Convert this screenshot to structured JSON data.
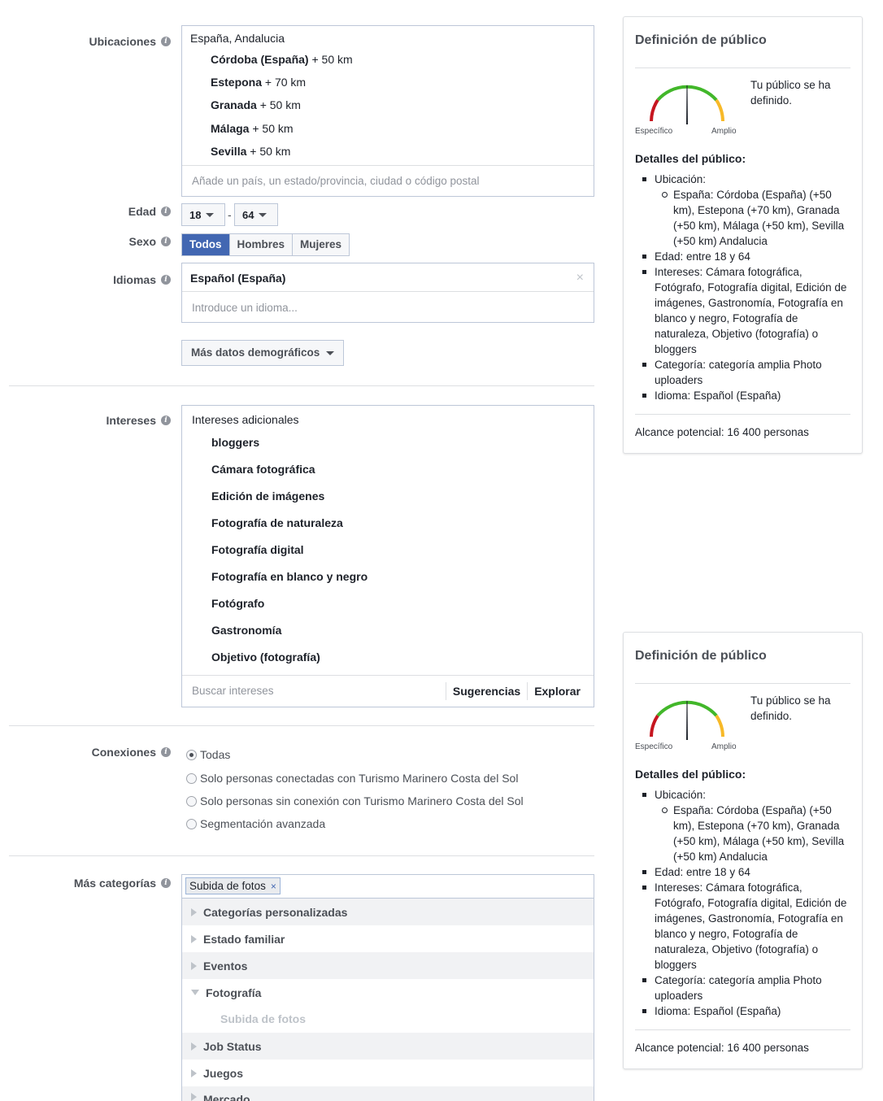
{
  "locations": {
    "label": "Ubicaciones",
    "region": "España, Andalucia",
    "items": [
      {
        "name": "Córdoba (España)",
        "radius": "+ 50 km"
      },
      {
        "name": "Estepona",
        "radius": "+ 70 km"
      },
      {
        "name": "Granada",
        "radius": "+ 50 km"
      },
      {
        "name": "Málaga",
        "radius": "+ 50 km"
      },
      {
        "name": "Sevilla",
        "radius": "+ 50 km"
      }
    ],
    "placeholder": "Añade un país, un estado/provincia, ciudad o código postal"
  },
  "age": {
    "label": "Edad",
    "min": "18",
    "separator": "-",
    "max": "64"
  },
  "gender": {
    "label": "Sexo",
    "options": [
      "Todos",
      "Hombres",
      "Mujeres"
    ],
    "selected": "Todos"
  },
  "languages": {
    "label": "Idiomas",
    "selected": "Español (España)",
    "remove": "×",
    "placeholder": "Introduce un idioma..."
  },
  "more_demographics": {
    "label": "Más datos demográficos"
  },
  "interests": {
    "label": "Intereses",
    "header": "Intereses adicionales",
    "items": [
      "bloggers",
      "Cámara fotográfica",
      "Edición de imágenes",
      "Fotografía de naturaleza",
      "Fotografía digital",
      "Fotografía en blanco y negro",
      "Fotógrafo",
      "Gastronomía",
      "Objetivo (fotografía)"
    ],
    "placeholder": "Buscar intereses",
    "suggestions": "Sugerencias",
    "explore": "Explorar"
  },
  "connections": {
    "label": "Conexiones",
    "options": [
      "Todas",
      "Solo personas conectadas con Turismo Marinero Costa del Sol",
      "Solo personas sin conexión con Turismo Marinero Costa del Sol",
      "Segmentación avanzada"
    ],
    "selected_index": 0
  },
  "more_categories": {
    "label": "Más categorías",
    "tag": "Subida de fotos",
    "tag_remove": "×",
    "tree": [
      {
        "label": "Categorías personalizadas",
        "expanded": false
      },
      {
        "label": "Estado familiar",
        "expanded": false
      },
      {
        "label": "Eventos",
        "expanded": false
      },
      {
        "label": "Fotografía",
        "expanded": true
      },
      {
        "label": "Subida de fotos",
        "child": true
      },
      {
        "label": "Job Status",
        "expanded": false
      },
      {
        "label": "Juegos",
        "expanded": false
      },
      {
        "label": "Mercado",
        "expanded": false
      }
    ]
  },
  "audience_card": {
    "title": "Definición de público",
    "gauge_status": "Tu público se ha definido.",
    "gauge_left": "Específico",
    "gauge_right": "Amplio",
    "details_title": "Detalles del público:",
    "location_label": "Ubicación:",
    "location_detail": "España: Córdoba (España) (+50 km), Estepona (+70 km), Granada (+50 km), Málaga (+50 km), Sevilla (+50 km) Andalucia",
    "age": "Edad: entre 18 y 64",
    "interests": "Intereses: Cámara fotográfica, Fotógrafo, Fotografía digital, Edición de imágenes, Gastronomía, Fotografía en blanco y negro, Fotografía de naturaleza, Objetivo (fotografía) o bloggers",
    "category": "Categoría: categoría amplia Photo uploaders",
    "language": "Idioma: Español (España)",
    "reach": "Alcance potencial: 16 400 personas"
  },
  "colors": {
    "accent": "#4267b2",
    "gauge_green": "#42b72a",
    "gauge_red": "#c6151f",
    "gauge_orange": "#f7b928"
  }
}
